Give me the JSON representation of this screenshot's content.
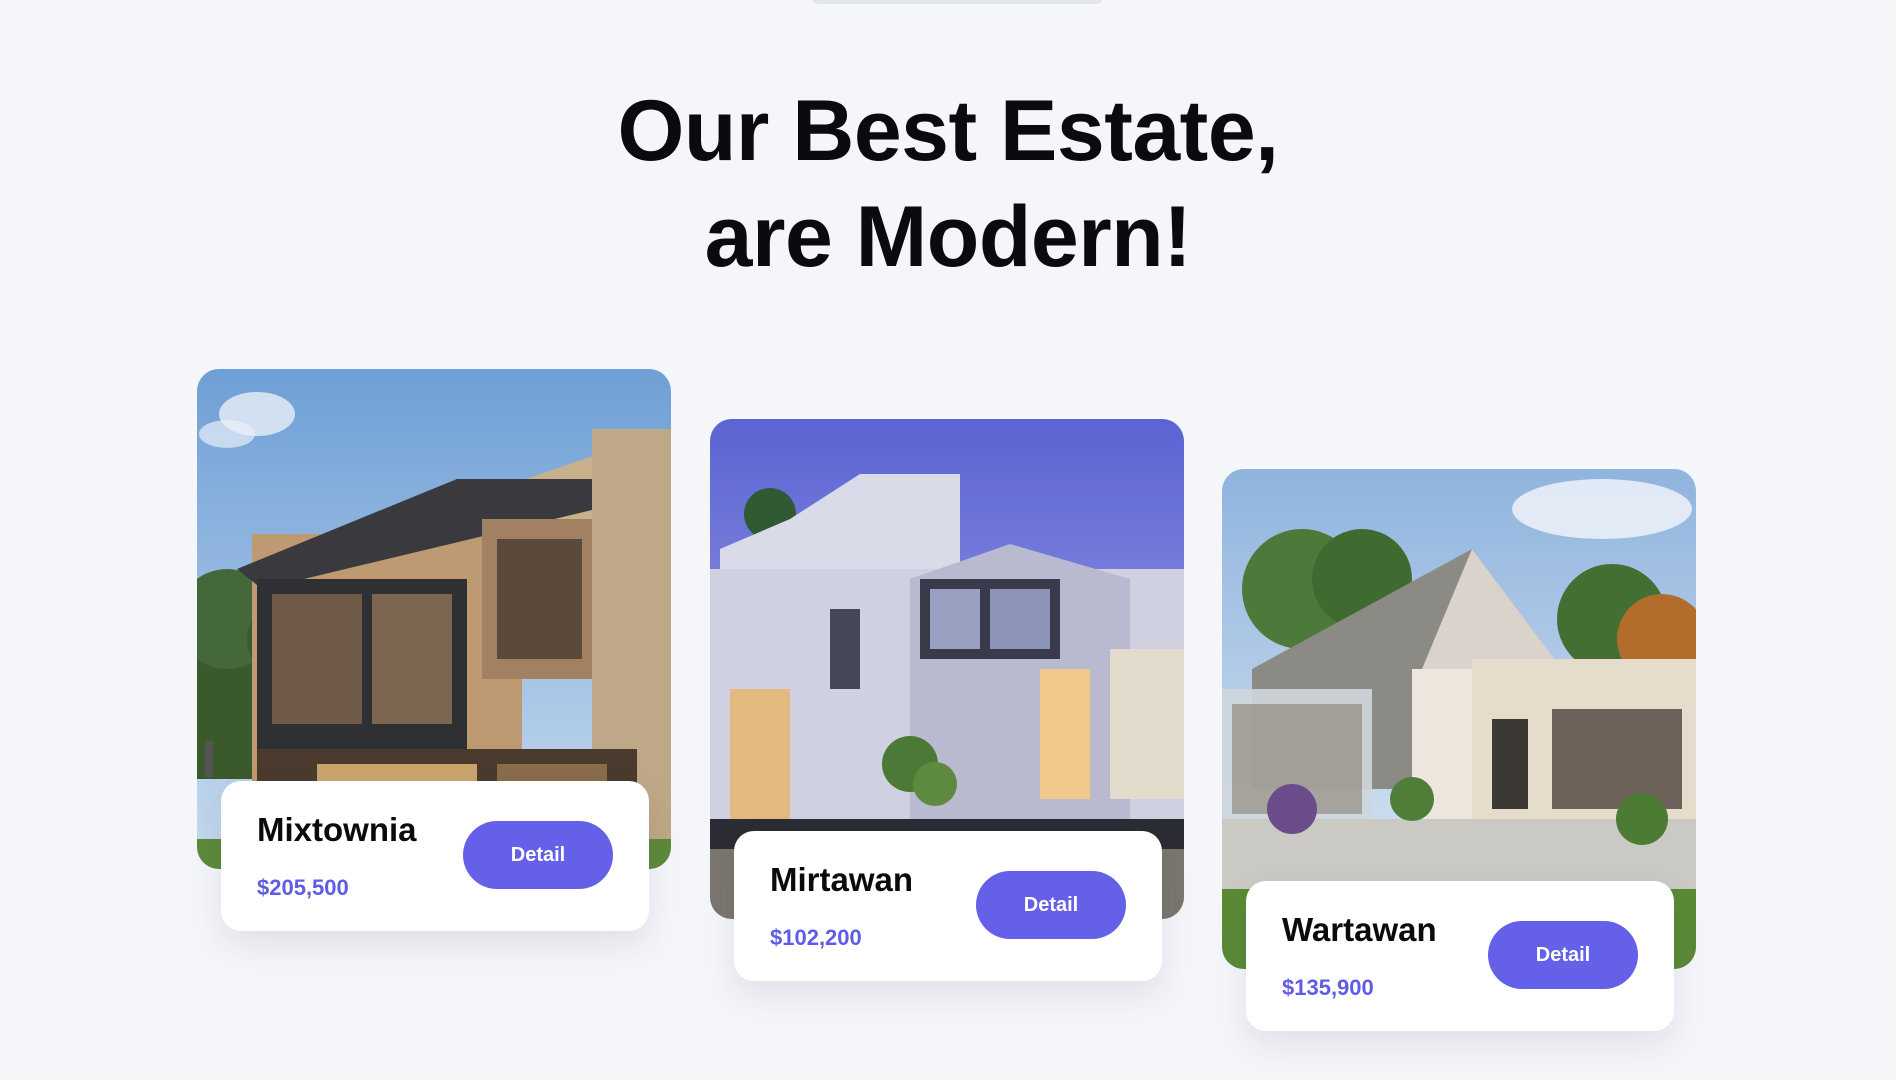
{
  "heading": {
    "line1": "Our Best Estate,",
    "line2": "are Modern!"
  },
  "cards": [
    {
      "name": "Mixtownia",
      "price": "$205,500",
      "button_label": "Detail"
    },
    {
      "name": "Mirtawan",
      "price": "$102,200",
      "button_label": "Detail"
    },
    {
      "name": "Wartawan",
      "price": "$135,900",
      "button_label": "Detail"
    }
  ],
  "colors": {
    "background": "#f5f6fa",
    "accent": "#6460e8",
    "price": "#5f5ce6",
    "heading": "#0b0b0f"
  }
}
